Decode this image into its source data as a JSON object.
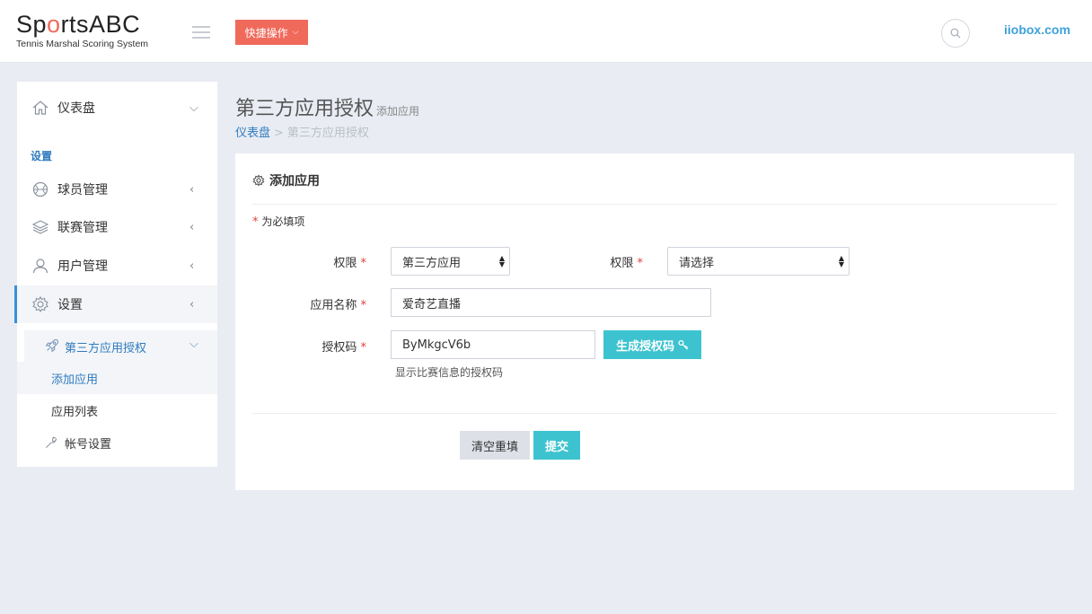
{
  "header": {
    "logo_prefix": "Sp",
    "logo_o": "o",
    "logo_suffix": "rtsABC",
    "logo_subtitle": "Tennis Marshal Scoring System",
    "quick_action_label": "快捷操作",
    "domain_link": "iiobox.com",
    "brand_color": "#f06a5c",
    "accent_color": "#3dc3cf"
  },
  "sidebar": {
    "dashboard_label": "仪表盘",
    "section_title": "设置",
    "items": [
      {
        "label": "球员管理",
        "icon": "basketball-icon"
      },
      {
        "label": "联赛管理",
        "icon": "layers-icon"
      },
      {
        "label": "用户管理",
        "icon": "user-icon"
      },
      {
        "label": "设置",
        "icon": "gear-icon"
      }
    ],
    "submenu": {
      "parent_label": "第三方应用授权",
      "children": [
        "添加应用",
        "应用列表"
      ],
      "account_label": "帐号设置"
    }
  },
  "page": {
    "title": "第三方应用授权",
    "subtitle": "添加应用",
    "breadcrumb_home": "仪表盘",
    "breadcrumb_sep": ">",
    "breadcrumb_current": "第三方应用授权"
  },
  "form": {
    "panel_title": "添加应用",
    "required_note": "为必填项",
    "required_mark": "*",
    "permission_label": "权限",
    "permission_value": "第三方应用",
    "permission2_label": "权限",
    "permission2_value": "请选择",
    "app_name_label": "应用名称",
    "app_name_value": "爱奇艺直播",
    "auth_code_label": "授权码",
    "auth_code_value": "ByMkgcV6b",
    "generate_button": "生成授权码",
    "auth_code_hint": "显示比赛信息的授权码",
    "reset_button": "清空重填",
    "submit_button": "提交"
  }
}
